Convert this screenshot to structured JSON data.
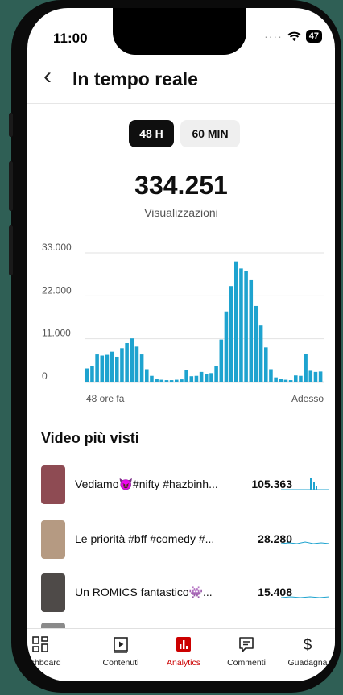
{
  "status": {
    "time": "11:00",
    "battery": "47"
  },
  "header": {
    "title": "In tempo reale"
  },
  "segments": {
    "active": "48 H",
    "inactive": "60 MIN"
  },
  "total": {
    "value": "334.251",
    "label": "Visualizzazioni"
  },
  "chart_data": {
    "type": "bar",
    "ylim": [
      0,
      33000
    ],
    "yticks": [
      "33.000",
      "22.000",
      "11.000",
      "0"
    ],
    "xlabel_start": "48 ore fa",
    "xlabel_end": "Adesso",
    "grid": true,
    "color": "#1ea3cf",
    "values": [
      3400,
      4100,
      7000,
      6700,
      6900,
      7700,
      6400,
      8600,
      9900,
      11100,
      9000,
      7000,
      3200,
      1500,
      800,
      500,
      400,
      400,
      500,
      600,
      3000,
      1400,
      1500,
      2500,
      2000,
      2200,
      4000,
      10800,
      18000,
      24500,
      30800,
      29000,
      28300,
      26000,
      19400,
      14400,
      8800,
      3200,
      1100,
      700,
      500,
      400,
      1600,
      1500,
      7100,
      2800,
      2500,
      2600
    ]
  },
  "top_videos": {
    "title": "Video più visti",
    "items": [
      {
        "title": "Vediamo😈#nifty #hazbinh...",
        "views": "105.363",
        "thumb": "#8e4b53"
      },
      {
        "title": "Le priorità #bff #comedy #...",
        "views": "28.280",
        "thumb": "#b59a82"
      },
      {
        "title": "Un ROMICS fantastico👾...",
        "views": "15.408",
        "thumb": "#4e4a48"
      }
    ]
  },
  "nav": [
    {
      "label": "Dashboard",
      "icon": "dashboard-icon"
    },
    {
      "label": "Contenuti",
      "icon": "content-icon"
    },
    {
      "label": "Analytics",
      "icon": "analytics-icon"
    },
    {
      "label": "Commenti",
      "icon": "comments-icon"
    },
    {
      "label": "Guadagna",
      "icon": "dollar-icon"
    }
  ],
  "colors": {
    "accent": "#cc0000",
    "bar": "#1ea3cf",
    "background": "#2f5f55"
  }
}
